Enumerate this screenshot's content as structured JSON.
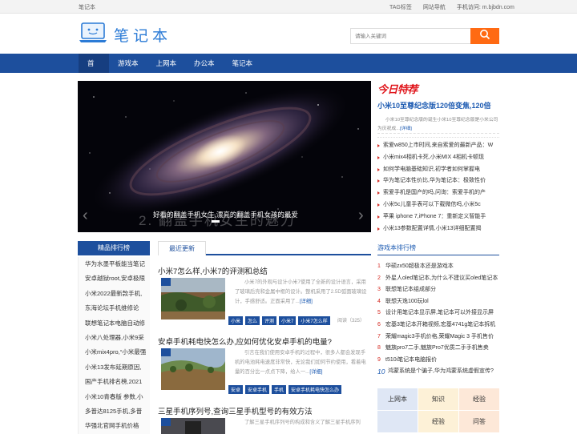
{
  "topbar": {
    "site_name": "笔记本",
    "tag_link": "TAG标签",
    "site_nav": "网站导航",
    "mobile_label": "手机访问:",
    "mobile_url": "m.bjbdn.com"
  },
  "header": {
    "logo_text": "笔记本",
    "search_placeholder": "请输入关键词"
  },
  "nav": {
    "items": [
      "首页",
      "游戏本",
      "上网本",
      "办公本",
      "笔记本"
    ]
  },
  "hero": {
    "caption": "好看的翻盖手机女生,漂亮的翻盖手机女孩的最爱",
    "overlay_title": "2. 翻盖手机女生的魅力",
    "prev": "‹",
    "next": "›"
  },
  "today": {
    "logo": "今日特荐",
    "headline": "小米10至尊纪念版120倍变焦,120倍",
    "desc": "小米10至尊纪念版的诞生小米10至尊纪念版是小米公司为庆祝成...",
    "more": "[详细]",
    "items": [
      "索爱w850上市时间,来自索爱的最新产品：W",
      "小米mix4相机卡死,小米MIX 4相机卡顿现",
      "如何学电脑基础知识,初学者如何掌握电",
      "华为笔记本性价比,华为笔记本：极致性价",
      "索爱手机是国产的吗,问询：索爱手机的产",
      "小米5c儿童手表可以下载微信吗,小米5c",
      "苹果 iphone 7,iPhone 7：重新定义智能手",
      "小米13参数配置详情,小米13详细配置揭"
    ]
  },
  "left_sidebar": {
    "title": "精品排行榜",
    "items": [
      "华为水墨平板能当笔记",
      "安卓越狱root,安卓极限",
      "小米2022最新款手机,",
      "东海论坛手机维修论",
      "联想笔记本电脑自动修",
      "小米八处理器,小米9采",
      "小米mix4pro,“小米最强",
      "小米13发布延期原因,",
      "国产手机排名榜,2021",
      "小米10青春版 参数,小",
      "多普达8125手机,多普",
      "华强北官网手机价格"
    ]
  },
  "main": {
    "tab": "最近更新",
    "articles": [
      {
        "title": "小米7怎么样,小米7的评测和总结",
        "excerpt": "小米7的外观与设计小米7使用了全新的设计语言，采用了玻璃后壳和金属中框的设计。整机采用了2.5D弧面玻璃设计，手感舒适。正面采用了...",
        "more": "[详细]",
        "tags": [
          "小米",
          "怎么",
          "评测",
          "小米7",
          "小米7怎么样"
        ],
        "views": "阅读（325）"
      },
      {
        "title": "安卓手机耗电快怎么办,应如何优化安卓手机的电量?",
        "excerpt": "引言在我们使用安卓手机的过程中，很多人都会发现手机的电池耗电速度非常快，无论我们如何节约使用，看着电量的百分比一点点下降，给人一...",
        "more": "[详细]",
        "tags": [
          "安卓",
          "安卓手机",
          "手机",
          "安卓手机耗电快怎么办"
        ],
        "views": ""
      },
      {
        "title": "三星手机序列号,查询三星手机型号的有效方法",
        "excerpt": "了解三星手机序列号的构成和含义了解三星手机序列",
        "more": "",
        "tags": [],
        "views": ""
      }
    ]
  },
  "game": {
    "title": "游戏本排行榜",
    "items": [
      "华硕zx50超极本还是游戏本",
      "外星人oled笔记本,为什么不建议买oled笔记本",
      "联想笔记本组成部分",
      "联想天逸100玩lol",
      "设计用笔记本显示屏,笔记本可以外接显示屏",
      "宏基3笔记本开箱视频,宏基4741g笔记本拆机",
      "荣耀magic3手机价格,荣耀Magic 3 手机售价",
      "魅族pro7二手,魅族Pro7优质二手手机售卖",
      "t510i笔记本电脑报价",
      "鸿蒙系统是个骗子,华为鸿蒙系统虚假宣传?"
    ],
    "nums": [
      "1",
      "2",
      "3",
      "4",
      "5",
      "6",
      "7",
      "8",
      "9",
      "10"
    ]
  },
  "grid": {
    "cells": [
      "上网本",
      "知识",
      "经验",
      "",
      "经验",
      "问答"
    ]
  },
  "colors": {
    "nav": "#1d4f9d",
    "accent": "#ff6a13",
    "link": "#1d5bb2",
    "red": "#d52a22"
  }
}
